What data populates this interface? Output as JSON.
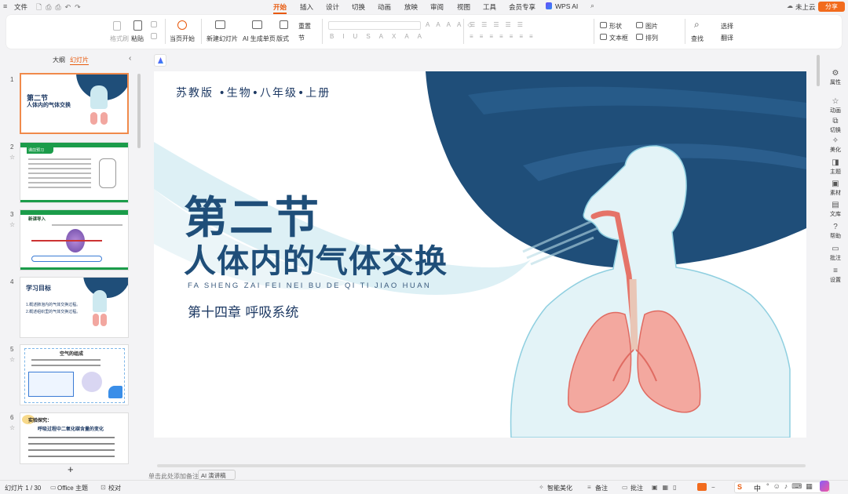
{
  "menubar": {
    "file": "文件",
    "tabs": [
      "开始",
      "插入",
      "设计",
      "切换",
      "动画",
      "放映",
      "审阅",
      "视图",
      "工具",
      "会员专享"
    ],
    "wps_ai": "WPS AI",
    "cloud": "未上云",
    "share": "分享"
  },
  "ribbon": {
    "format_painter": "格式刷",
    "paste": "粘贴",
    "play": "当页开始",
    "new_slide": "新建幻灯片",
    "ai_generate": "AI 生成单页",
    "layout": "版式",
    "reset": "重置",
    "section": "节",
    "shape": "形状",
    "picture": "图片",
    "textbox": "文本框",
    "arrange": "排列",
    "find": "查找",
    "select": "选择",
    "replace": "翻译"
  },
  "leftpanel": {
    "tab_outline": "大纲",
    "tab_slides": "幻灯片",
    "slide_numbers": [
      "1",
      "2",
      "3",
      "4",
      "5",
      "6"
    ],
    "thumbs": {
      "s1_title": "第二节",
      "s1_sub": "人体内的气体交换",
      "s2_title": "课前预习",
      "s3_title": "新课导入",
      "s4_title": "学习目标",
      "s4_line1": "1.概述肺泡内的气体交换过程。",
      "s4_line2": "2.概述组织里的气体交换过程。",
      "s5_title": "空气的组成",
      "s6_title": "实验探究：",
      "s6_sub": "呼吸过程中二氧化碳含量的变化"
    }
  },
  "slide": {
    "header": "苏教版 •生物•八年级•上册",
    "title1": "第二节",
    "title2": "人体内的气体交换",
    "pinyin": "FA SHENG ZAI FEI NEI BU DE QI TI JIAO HUAN",
    "chapter": "第十四章 呼吸系统"
  },
  "notes": {
    "placeholder": "单击此处添加备注",
    "ai_script": "AI 演讲稿"
  },
  "rightbar": [
    "属性",
    "动画",
    "切换",
    "美化",
    "主题",
    "素材",
    "文库",
    "帮助",
    "批注",
    "设置"
  ],
  "status": {
    "slide_counter": "幻灯片 1 / 30",
    "theme": "Office 主题",
    "proofread": "校对",
    "smart_beautify": "智能美化",
    "notes": "备注",
    "comments": "批注",
    "ime_lang": "中"
  },
  "colors": {
    "accent": "#e8590c",
    "slide_navy": "#1f4e79",
    "title_navy": "#1e3a64"
  }
}
